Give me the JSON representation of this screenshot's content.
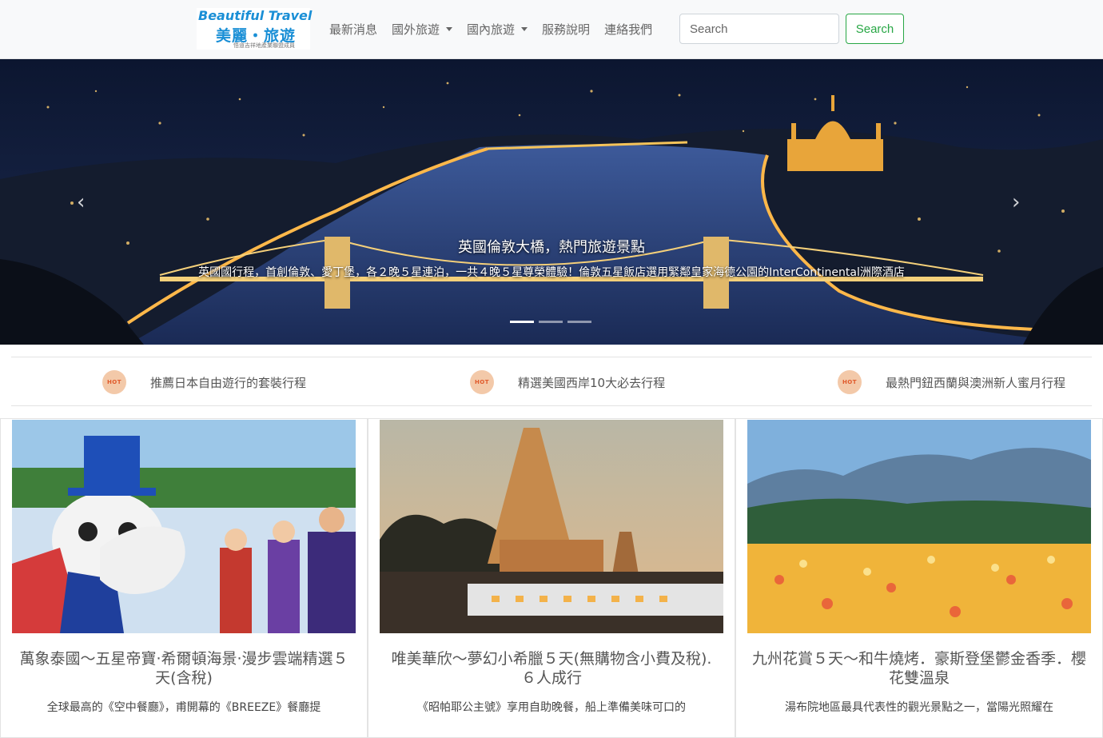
{
  "header": {
    "logo": {
      "en": "Beautiful Travel",
      "zh": "美麗・旅遊",
      "tagline": "悟道吉祥地產業聯盟成員"
    },
    "nav": [
      {
        "label": "最新消息",
        "dropdown": false
      },
      {
        "label": "國外旅遊",
        "dropdown": true
      },
      {
        "label": "國內旅遊",
        "dropdown": true
      },
      {
        "label": "服務說明",
        "dropdown": false
      },
      {
        "label": "連絡我們",
        "dropdown": false
      }
    ],
    "search": {
      "placeholder": "Search",
      "button_label": "Search"
    }
  },
  "carousel": {
    "title": "英國倫敦大橋，熱門旅遊景點",
    "text": "英國國行程，首創倫敦、愛丁堡，各２晚５星連泊，一共４晚５星尊榮體驗！倫敦五星飯店選用緊鄰皇家海德公園的InterContinental洲際酒店",
    "prev_icon": "chevron-left-icon",
    "next_icon": "chevron-right-icon",
    "slides": 3,
    "active_slide": 1
  },
  "hot_items": [
    {
      "badge": "HOT",
      "text": "推薦日本自由遊行的套裝行程"
    },
    {
      "badge": "HOT",
      "text": "精選美國西岸10大必去行程"
    },
    {
      "badge": "HOT",
      "text": "最熱門鈕西蘭與澳洲新人蜜月行程"
    }
  ],
  "cards": [
    {
      "title": "萬象泰國～五星帝寶‧希爾頓海景‧漫步雲端精選５天(含稅)",
      "desc": "全球最高的《空中餐廳》，甫開幕的《BREEZE》餐廳提"
    },
    {
      "title": "唯美華欣～夢幻小希臘５天(無購物含小費及稅).６人成行",
      "desc": "《昭帕耶公主號》享用自助晚餐，船上準備美味可口的"
    },
    {
      "title": "九州花賞５天～和牛燒烤．豪斯登堡鬱金香季．櫻花雙溫泉",
      "desc": "湯布院地區最具代表性的觀光景點之一，當陽光照耀在"
    }
  ],
  "colors": {
    "accent": "#28a745",
    "logo_blue": "#1a8fd6",
    "hot_badge": "#f3c9a9"
  }
}
